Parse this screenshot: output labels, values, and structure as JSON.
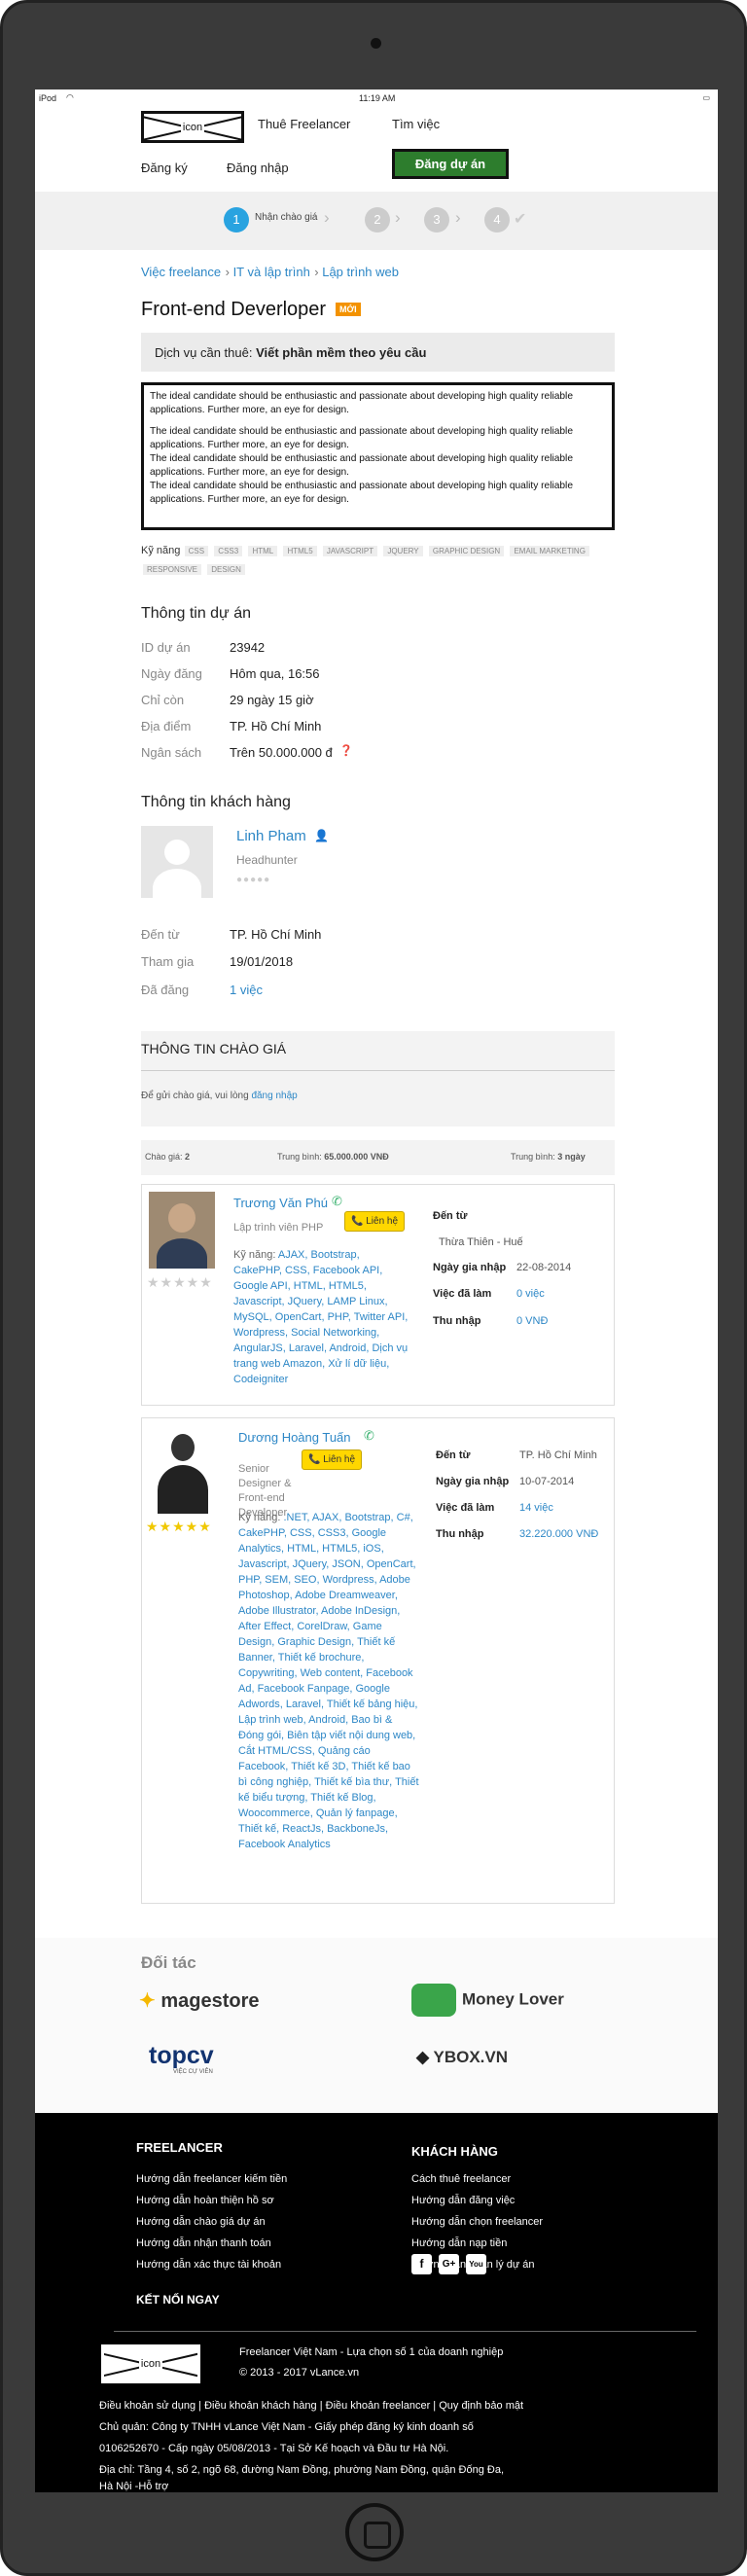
{
  "status_bar": {
    "device": "iPod",
    "time": "11:19 AM"
  },
  "header": {
    "logo_text": "icon",
    "nav": {
      "hire": "Thuê Freelancer",
      "find_job": "Tìm việc",
      "register": "Đăng ký",
      "login": "Đăng nhập"
    },
    "post_project": "Đăng dự án"
  },
  "steps": [
    {
      "num": "1",
      "label": "Nhận chào giá"
    },
    {
      "num": "2"
    },
    {
      "num": "3"
    },
    {
      "num": "4"
    }
  ],
  "breadcrumb": [
    "Việc freelance",
    "IT và lập trình",
    "Lập trình web"
  ],
  "job": {
    "title": "Front-end Deverloper",
    "badge": "MỚI",
    "service_label": "Dịch vụ cần thuê:",
    "service_value": "Viết phần mềm theo yêu cầu",
    "description": [
      "The ideal candidate should be enthusiastic and passionate about developing high quality reliable applications. Further more, an eye for design.",
      "The ideal candidate should be enthusiastic and passionate about developing high quality reliable applications. Further more, an eye for design.",
      "The ideal candidate should be enthusiastic and passionate about developing high quality reliable applications. Further more, an eye for design.",
      "The ideal candidate should be enthusiastic and passionate about developing high quality reliable applications. Further more, an eye for design."
    ],
    "skills_label": "Kỹ năng",
    "skills": [
      "CSS",
      "CSS3",
      "HTML",
      "HTML5",
      "JAVASCRIPT",
      "JQUERY",
      "GRAPHIC DESIGN",
      "EMAIL MARKETING",
      "RESPONSIVE",
      "DESIGN"
    ]
  },
  "project_info": {
    "heading": "Thông tin dự án",
    "rows": [
      {
        "k": "ID dự án",
        "v": "23942"
      },
      {
        "k": "Ngày đăng",
        "v": "Hôm qua, 16:56"
      },
      {
        "k": "Chỉ còn",
        "v": "29 ngày 15 giờ"
      },
      {
        "k": "Địa điểm",
        "v": "TP. Hồ Chí Minh"
      },
      {
        "k": "Ngân sách",
        "v": "Trên 50.000.000 đ"
      }
    ]
  },
  "client_info": {
    "heading": "Thông tin khách hàng",
    "name": "Linh Pham",
    "role": "Headhunter",
    "rows": [
      {
        "k": "Đến từ",
        "v": "TP. Hồ Chí Minh"
      },
      {
        "k": "Tham gia",
        "v": "19/01/2018"
      },
      {
        "k": "Đã đăng",
        "v": "1 việc"
      }
    ]
  },
  "offers": {
    "heading": "THÔNG TIN CHÀO GIÁ",
    "login_prompt": "Để gửi chào giá, vui lòng",
    "login_link": "đăng nhập",
    "stats": {
      "count_label": "Chào giá:",
      "count": "2",
      "avg_price_label": "Trung bình:",
      "avg_price": "65.000.000 VNĐ",
      "avg_days_label": "Trung bình:",
      "avg_days": "3 ngày"
    },
    "contact_label": "Liên hệ",
    "skills_label": "Kỹ năng:",
    "bids": [
      {
        "name": "Trương Văn Phú",
        "title": "Lập trình viên PHP",
        "skills": "AJAX, Bootstrap, CakePHP, CSS, Facebook API, Google API, HTML, HTML5, Javascript, JQuery, LAMP Linux, MySQL, OpenCart, PHP, Twitter API, Wordpress, Social Networking, AngularJS, Laravel, Android, Dịch vụ trang web Amazon, Xử lí dữ liệu, Codeigniter",
        "details": [
          {
            "k": "Đến từ",
            "v": "Thừa Thiên - Huế"
          },
          {
            "k": "Ngày gia nhập",
            "v": "22-08-2014"
          },
          {
            "k": "Việc đã làm",
            "v": "0 việc"
          },
          {
            "k": "Thu nhập",
            "v": "0 VNĐ"
          }
        ]
      },
      {
        "name": "Dương Hoàng Tuấn",
        "title": "Senior Designer & Front-end Developer",
        "skills": ".NET, AJAX, Bootstrap, C#, CakePHP, CSS, CSS3, Google Analytics, HTML, HTML5, iOS, Javascript, JQuery, JSON, OpenCart, PHP, SEM, SEO, Wordpress, Adobe Photoshop, Adobe Dreamweaver, Adobe Illustrator, Adobe InDesign, After Effect, CorelDraw, Game Design, Graphic Design, Thiết kế Banner, Thiết kế brochure, Copywriting, Web content, Facebook Ad, Facebook Fanpage, Google Adwords, Laravel, Thiết kế bảng hiệu, Lập trình web, Android, Bao bì & Đóng gói, Biên tập viết nội dung web, Cắt HTML/CSS, Quảng cáo Facebook, Thiết kế 3D, Thiết kế bao bì công nghiệp, Thiết kế bìa thư, Thiết kế biểu tượng, Thiết kế Blog, Woocommerce, Quản lý fanpage, Thiết kế, ReactJs, BackboneJs, Facebook Analytics",
        "details": [
          {
            "k": "Đến từ",
            "v": "TP. Hồ Chí Minh"
          },
          {
            "k": "Ngày gia nhập",
            "v": "10-07-2014"
          },
          {
            "k": "Việc đã làm",
            "v": "14 việc"
          },
          {
            "k": "Thu nhập",
            "v": "32.220.000 VNĐ"
          }
        ]
      }
    ]
  },
  "partners": {
    "heading": "Đối tác",
    "logos": [
      "magestore",
      "Money Lover",
      "topcv",
      "YBOX.VN"
    ],
    "topcv_tagline": "VIỆC CỰ VIÊN"
  },
  "footer": {
    "freelancer_heading": "FREELANCER",
    "freelancer_links": [
      "Hướng dẫn freelancer kiếm tiền",
      "Hướng dẫn hoàn thiện hồ sơ",
      "Hướng dẫn chào giá dự án",
      "Hướng dẫn nhận thanh toán",
      "Hướng dẫn xác thực tài khoản"
    ],
    "client_heading": "KHÁCH HÀNG",
    "client_links": [
      "Cách thuê freelancer",
      "Hướng dẫn đăng việc",
      "Hướng dẫn chọn freelancer",
      "Hướng dẫn nạp tiền",
      "Hướng dẫn quản lý dự án"
    ],
    "connect_heading": "KẾT NỐI NGAY",
    "social": [
      "f",
      "G+",
      "You"
    ],
    "tagline": "Freelancer Việt Nam - Lựa chọn số 1 của doanh nghiệp",
    "copyright": "© 2013 - 2017 vLance.vn",
    "legal": "Điều khoản sử dụng | Điều khoản khách hàng | Điều khoản freelancer | Quy định bảo mật",
    "owner": "Chủ quản: Công ty TNHH vLance Việt Nam - Giấy phép đăng ký kinh doanh số",
    "license": "0106252670 - Cấp ngày 05/08/2013 - Tại Sở Kế hoạch và Đầu tư Hà Nội.",
    "address": "Địa chỉ: Tầng 4, số 2, ngõ 68, đường Nam Đồng, phường Nam Đồng, quận Đống Đa,",
    "address2": "Hà Nội -Hỗ trợ"
  }
}
